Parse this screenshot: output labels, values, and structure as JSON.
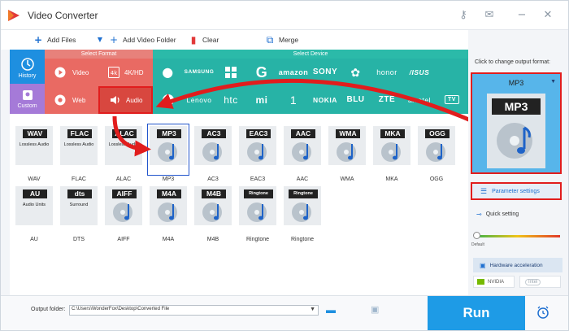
{
  "app": {
    "title": "Video Converter"
  },
  "toolbar": {
    "add_files": "Add Files",
    "add_video_folder": "Add Video Folder",
    "clear": "Clear",
    "merge": "Merge"
  },
  "categories": {
    "select_format_label": "Select Format",
    "select_device_label": "Select Device",
    "history": "History",
    "custom": "Custom",
    "video": "Video",
    "web": "Web",
    "fourk": "4K/HD",
    "audio": "Audio"
  },
  "devices": {
    "row1": [
      "",
      "SAMSUNG",
      "",
      "G",
      "amazon",
      "SONY",
      "",
      "honor",
      "/ISUS"
    ],
    "row2": [
      "",
      "Lenovo",
      "htc",
      "mi",
      "1",
      "NOKIA",
      "BLU",
      "ZTE",
      "alcatel",
      "TV"
    ]
  },
  "formats": {
    "row1": [
      {
        "badge": "WAV",
        "label": "WAV",
        "sub": "Lossless Audio"
      },
      {
        "badge": "FLAC",
        "label": "FLAC",
        "sub": "Lossless Audio"
      },
      {
        "badge": "ALAC",
        "label": "ALAC",
        "sub": "Lossless Audio"
      },
      {
        "badge": "MP3",
        "label": "MP3",
        "sub": ""
      },
      {
        "badge": "AC3",
        "label": "AC3",
        "sub": ""
      },
      {
        "badge": "EAC3",
        "label": "EAC3",
        "sub": ""
      },
      {
        "badge": "AAC",
        "label": "AAC",
        "sub": ""
      },
      {
        "badge": "WMA",
        "label": "WMA",
        "sub": ""
      },
      {
        "badge": "MKA",
        "label": "MKA",
        "sub": ""
      },
      {
        "badge": "OGG",
        "label": "OGG",
        "sub": ""
      }
    ],
    "row2": [
      {
        "badge": "AU",
        "label": "AU",
        "sub": "Audio Units"
      },
      {
        "badge": "dts",
        "label": "DTS",
        "sub": "Surround"
      },
      {
        "badge": "AIFF",
        "label": "AIFF",
        "sub": ""
      },
      {
        "badge": "M4A",
        "label": "M4A",
        "sub": ""
      },
      {
        "badge": "M4B",
        "label": "M4B",
        "sub": ""
      },
      {
        "badge": "Ringtone",
        "label": "Ringtone",
        "sub": ""
      },
      {
        "badge": "Ringtone",
        "label": "Ringtone",
        "sub": ""
      }
    ]
  },
  "panel": {
    "hint": "Click to change output format:",
    "selected_format": "MP3",
    "badge": "MP3",
    "parameter_settings": "Parameter settings",
    "quick_setting": "Quick setting",
    "slider_default": "Default",
    "hardware_acceleration": "Hardware acceleration",
    "nvidia": "NVIDIA",
    "intel": "Intel"
  },
  "bottom": {
    "output_label": "Output folder:",
    "output_path": "C:\\Users\\WonderFox\\Desktop\\Converted File",
    "run": "Run"
  },
  "colors": {
    "accent_blue": "#1e8fe0",
    "teal": "#27b3a6",
    "salmon": "#e96a63",
    "red_highlight": "#e11d1d",
    "purple": "#a57ad8"
  },
  "icons": {
    "apple": "apple-icon",
    "microsoft": "microsoft-icon",
    "google": "google-icon",
    "huawei": "huawei-icon"
  }
}
